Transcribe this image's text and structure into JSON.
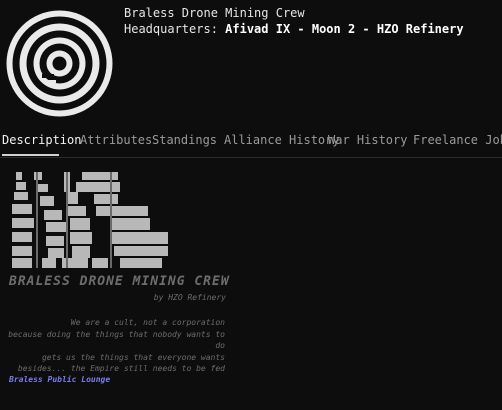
{
  "header": {
    "corp_name": "Braless Drone Mining Crew",
    "hq_label": "Headquarters:",
    "hq_value": "Afivad IX - Moon 2 - HZO Refinery"
  },
  "tabs": [
    {
      "label": "Description",
      "active": true
    },
    {
      "label": "Attributes",
      "active": false
    },
    {
      "label": "Standings",
      "active": false
    },
    {
      "label": "Alliance History",
      "active": false
    },
    {
      "label": "War History",
      "active": false
    },
    {
      "label": "Freelance Jobs",
      "active": false
    }
  ],
  "description": {
    "banner_icon": "bdmc-ascii-banner",
    "crew_title": "BRALESS DRONE MINING CREW",
    "by_line": "by HZO Refinery",
    "motto": [
      "We are a cult, not a corporation",
      "because doing the things that nobody wants to do",
      "gets us the things that everyone wants",
      "besides... the Empire still needs to be fed"
    ],
    "link": "Braless Public Lounge"
  },
  "colors": {
    "background": "#0d0d0d",
    "text": "#d8d8d8",
    "muted": "#6d6d6d",
    "link": "#7b7bf0"
  }
}
